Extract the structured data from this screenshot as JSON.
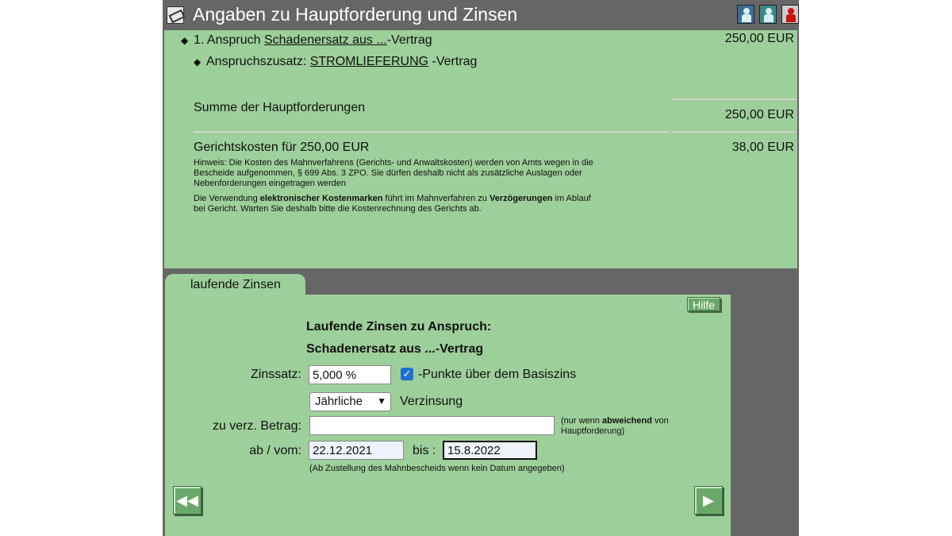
{
  "window": {
    "title": "Angaben zu Hauptforderung und Zinsen",
    "title_icon": "form-icon",
    "toolbar_icons": [
      "user-group-icon",
      "user-info-icon",
      "user-alert-icon"
    ]
  },
  "claims": {
    "claim_prefix": "1. Anspruch",
    "claim_link": "Schadenersatz aus ...",
    "claim_suffix": "-Vertrag",
    "claim_amount": "250,00 EUR",
    "addition_label": "Anspruchszusatz:",
    "addition_link": "STROMLIEFERUNG",
    "addition_suffix": "-Vertrag",
    "sum_label": "Summe der Hauptforderungen",
    "sum_amount": "250,00 EUR",
    "court_costs_label": "Gerichtskosten für 250,00 EUR",
    "court_costs_amount": "38,00 EUR",
    "note_line1": "Hinweis: Die Kosten des Mahnverfahrens (Gerichts- und Anwaltskosten) werden von Amts wegen in die",
    "note_line2": "Bescheide aufgenommen, § 699 Abs. 3 ZPO. Sie dürfen deshalb nicht als zusätzliche Auslagen oder",
    "note_line3": "Nebenforderungen eingetragen werden",
    "note2_a": "Die Verwendung ",
    "note2_b": "elektronischer Kostenmarken",
    "note2_c": " führt im Mahnverfahren zu ",
    "note2_d": "Verzögerungen",
    "note2_e": " im Ablauf",
    "note2_line2": "bei Gericht. Warten Sie deshalb bitte die Kostenrechnung des Gerichts ab."
  },
  "interest": {
    "tab_label": "laufende Zinsen",
    "help_label": "Hilfe",
    "heading1": "Laufende Zinsen zu Anspruch:",
    "heading2": "Schadenersatz aus ...-Vertrag",
    "rate_label": "Zinssatz:",
    "rate_value": "5,000 %",
    "base_rate_checked": true,
    "base_rate_label": "-Punkte über dem Basiszins",
    "frequency_value": "Jährliche",
    "frequency_suffix": "Verzinsung",
    "amount_label": "zu verz. Betrag:",
    "amount_value": "",
    "amount_hint_a": "(nur wenn ",
    "amount_hint_b": "abweichend",
    "amount_hint_c": " von",
    "amount_hint_line2": "Hauptforderung)",
    "from_label": "ab / vom:",
    "from_value": "22.12.2021",
    "to_label": "bis :",
    "to_value": "15.8.2022",
    "date_hint": "(Ab Zustellung des Mahnbescheids wenn kein Datum angegeben)",
    "back_icon": "double-left-arrow-icon",
    "next_icon": "right-arrow-icon"
  }
}
